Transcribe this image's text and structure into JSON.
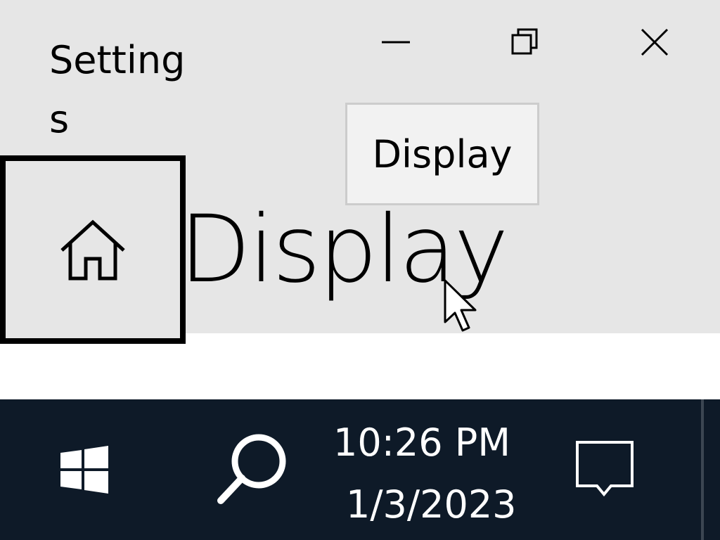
{
  "window": {
    "app_title": "Settings",
    "tooltip_text": "Display",
    "page_title": "Display",
    "icons": {
      "minimize": "minimize-icon",
      "restore": "restore-icon",
      "close": "close-icon",
      "home": "home-icon",
      "cursor": "cursor-icon"
    },
    "colors": {
      "titlebar_bg": "#e6e6e6",
      "content_bg": "#ffffff",
      "focus_border": "#000000"
    }
  },
  "taskbar": {
    "time": "10:26 PM",
    "date": "1/3/2023",
    "icons": {
      "start": "windows-logo-icon",
      "search": "search-icon",
      "action_center": "notification-icon"
    },
    "colors": {
      "background": "#0e1a28",
      "foreground": "#ffffff"
    }
  }
}
